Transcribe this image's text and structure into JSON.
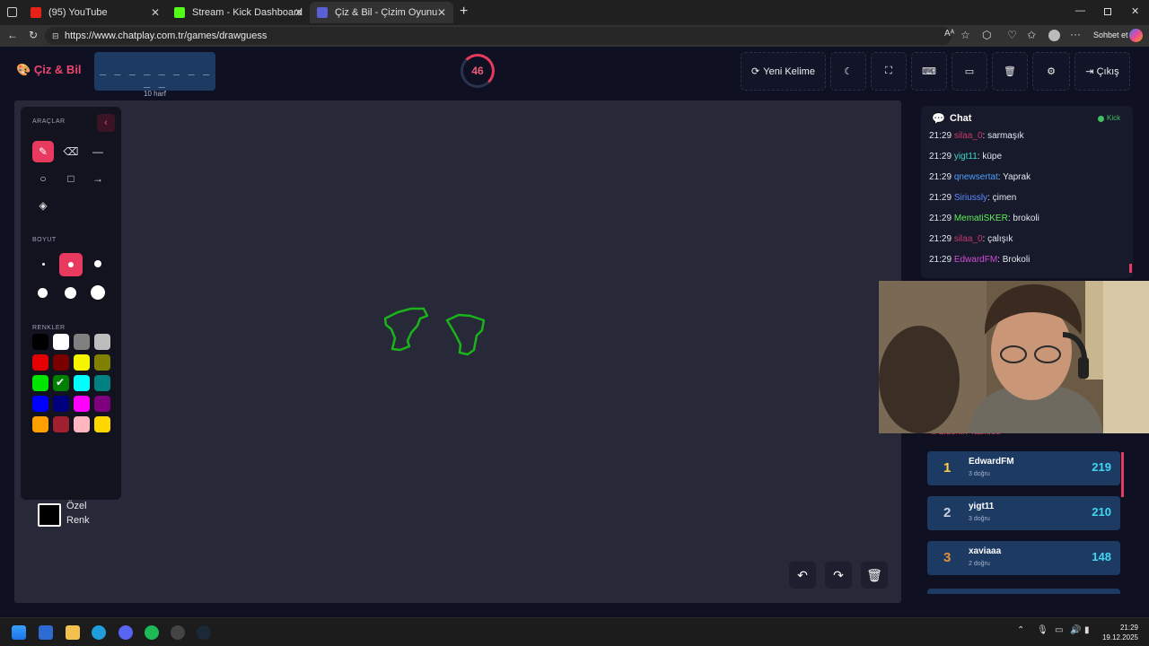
{
  "browser": {
    "tabs": [
      {
        "title": "(95) YouTube",
        "color": "#e62117"
      },
      {
        "title": "Stream - Kick Dashboard",
        "color": "#53fc18"
      },
      {
        "title": "Çiz & Bil - Çizim Oyunu",
        "color": "#5a5fd6"
      }
    ],
    "url": "https://www.chatplay.com.tr/games/drawguess",
    "chat_button": "Sohbet et"
  },
  "app": {
    "logo": "Çiz & Bil",
    "word_mask": "_ _ _ _ _ _ _ _ _ _",
    "word_length": "10 harf",
    "timer": "46",
    "buttons": {
      "new_word": "Yeni Kelime",
      "exit": "Çıkış"
    }
  },
  "tools": {
    "section_tools": "ARAÇLAR",
    "section_size": "BOYUT",
    "section_colors": "RENKLER",
    "custom_color_line1": "Özel",
    "custom_color_line2": "Renk",
    "colors": [
      "#000000",
      "#ffffff",
      "#808080",
      "#bdbdbd",
      "#e50000",
      "#7a0000",
      "#f5f500",
      "#7f7f00",
      "#00e400",
      "#008000",
      "#00ffff",
      "#008080",
      "#0000ff",
      "#00007f",
      "#ff00ff",
      "#7f007f",
      "#ff9f00",
      "#a02030",
      "#ffb6c1",
      "#ffd700"
    ],
    "selected_color": "#008000"
  },
  "chat": {
    "title": "Chat",
    "platform": "Kick",
    "messages": [
      {
        "time": "21:29",
        "user": "silaa_0",
        "text": "sarmaşık",
        "color": "#c9386b"
      },
      {
        "time": "21:29",
        "user": "yigt11",
        "text": "küpe",
        "color": "#3fd7c8"
      },
      {
        "time": "21:29",
        "user": "qnewsertat",
        "text": "Yaprak",
        "color": "#4d9fff"
      },
      {
        "time": "21:29",
        "user": "Siriussly",
        "text": "çimen",
        "color": "#5b8cff"
      },
      {
        "time": "21:29",
        "user": "MematiSKER",
        "text": "brokoli",
        "color": "#5ff05a"
      },
      {
        "time": "21:29",
        "user": "silaa_0",
        "text": "çalışık",
        "color": "#c9386b"
      },
      {
        "time": "21:29",
        "user": "EdwardFM",
        "text": "Brokoli",
        "color": "#d24bd6"
      }
    ]
  },
  "leaderboard": {
    "title": "Liderlik Tablosu",
    "rows": [
      {
        "rank": "1",
        "name": "EdwardFM",
        "correct": "3 doğru",
        "score": "219",
        "rank_color": "#ffd23f"
      },
      {
        "rank": "2",
        "name": "yigt11",
        "correct": "3 doğru",
        "score": "210",
        "rank_color": "#c9d2e3"
      },
      {
        "rank": "3",
        "name": "xaviaaa",
        "correct": "2 doğru",
        "score": "148",
        "rank_color": "#e0913f"
      }
    ]
  },
  "taskbar": {
    "time": "21:29",
    "date": "19.12.2025"
  }
}
